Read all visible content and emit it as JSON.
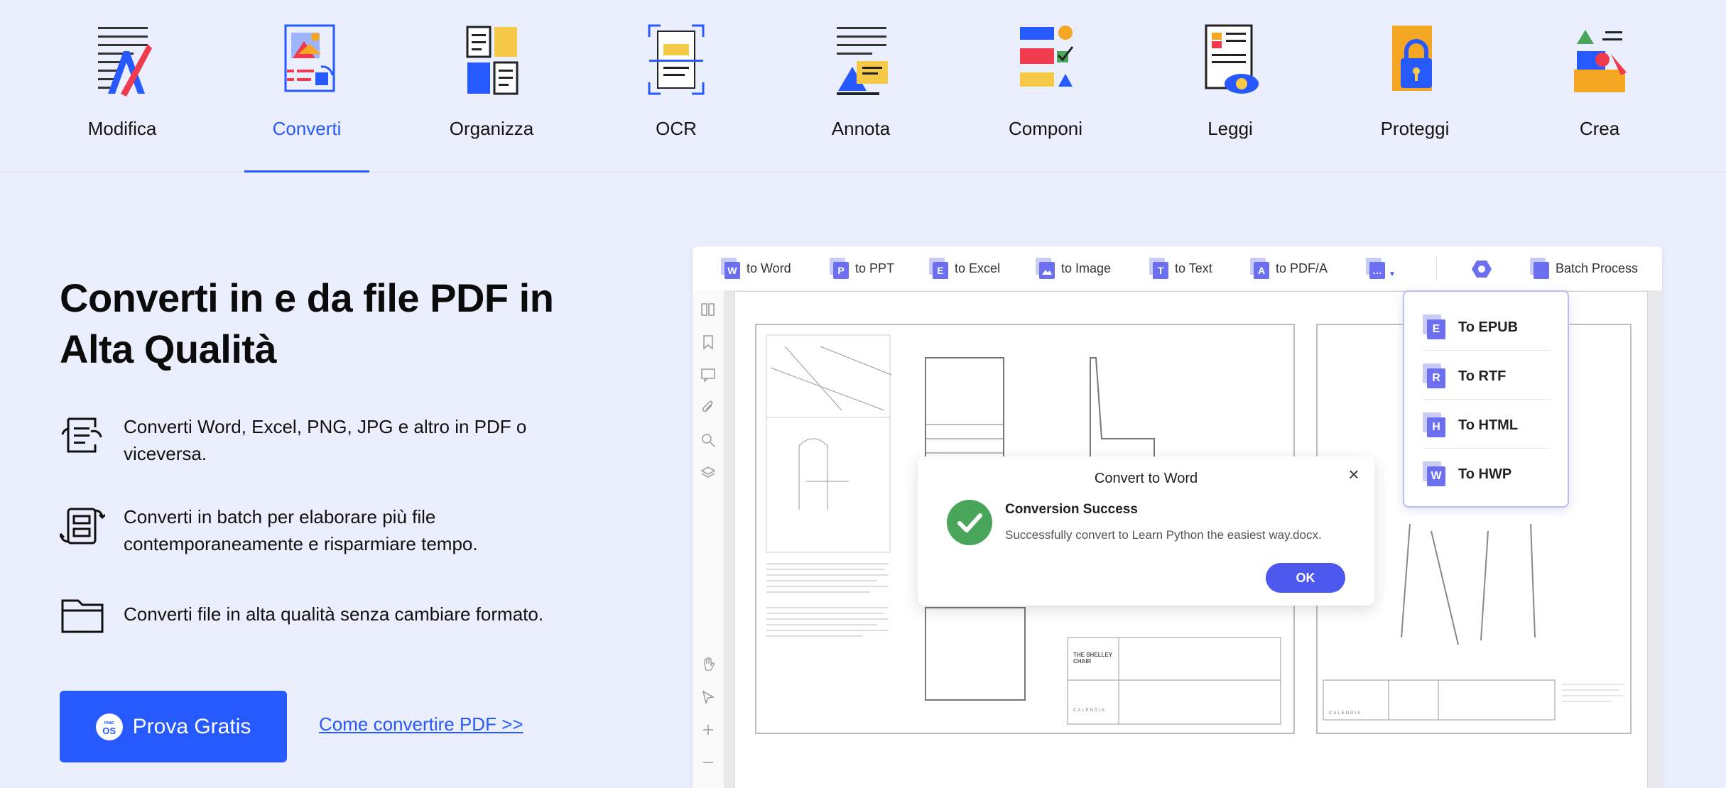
{
  "nav": {
    "items": [
      {
        "label": "Modifica",
        "icon": "edit-icon"
      },
      {
        "label": "Converti",
        "icon": "convert-icon",
        "active": true
      },
      {
        "label": "Organizza",
        "icon": "organize-icon"
      },
      {
        "label": "OCR",
        "icon": "ocr-icon"
      },
      {
        "label": "Annota",
        "icon": "annotate-icon"
      },
      {
        "label": "Componi",
        "icon": "compose-icon"
      },
      {
        "label": "Leggi",
        "icon": "read-icon"
      },
      {
        "label": "Proteggi",
        "icon": "protect-icon"
      },
      {
        "label": "Crea",
        "icon": "create-icon"
      }
    ]
  },
  "hero": {
    "title_line1": "Converti in e da file PDF in",
    "title_line2": "Alta Qualità",
    "features": [
      {
        "icon": "convert-doc-icon",
        "text": "Converti Word, Excel, PNG, JPG e altro in PDF o viceversa."
      },
      {
        "icon": "batch-icon",
        "text": "Converti in batch per elaborare più file contemporaneamente e risparmiare tempo."
      },
      {
        "icon": "folder-icon",
        "text": "Converti file in alta qualità senza cambiare formato."
      }
    ],
    "cta_label": "Prova Gratis",
    "cta_badge_top": "mac",
    "cta_badge_bottom": "OS",
    "link_label": "Come convertire PDF >>"
  },
  "app": {
    "toolbar": [
      {
        "letter": "W",
        "label": "to Word"
      },
      {
        "letter": "P",
        "label": "to PPT"
      },
      {
        "letter": "E",
        "label": "to Excel"
      },
      {
        "letter": "",
        "label": "to Image"
      },
      {
        "letter": "T",
        "label": "to Text"
      },
      {
        "letter": "A",
        "label": "to PDF/A"
      }
    ],
    "more_label": "…",
    "batch_label": "Batch Process",
    "dropdown": [
      {
        "letter": "E",
        "label": "To EPUB"
      },
      {
        "letter": "R",
        "label": "To RTF"
      },
      {
        "letter": "H",
        "label": "To HTML"
      },
      {
        "letter": "W",
        "label": "To HWP"
      }
    ],
    "modal": {
      "title": "Convert to Word",
      "close": "×",
      "heading": "Conversion Success",
      "message": "Successfully convert to Learn Python the easiest way.docx.",
      "ok": "OK"
    },
    "drawing": {
      "title_block_1": "THE SHELLEY CHAIR",
      "brand": "CALENDIA"
    }
  },
  "colors": {
    "accent": "#2659ff",
    "background": "#ebeefc",
    "modal_button": "#4c58ee",
    "success": "#49a55a"
  }
}
